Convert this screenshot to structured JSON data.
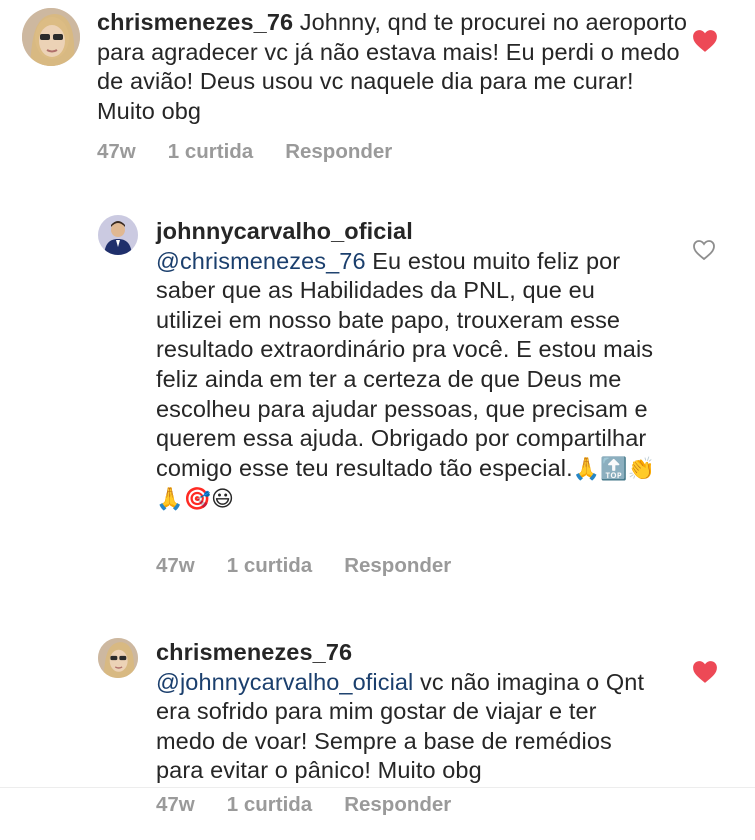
{
  "comments": [
    {
      "username": "chrismenezes_76",
      "mention": "",
      "body": " Johnny, qnd te procurei no aeroporto para agradecer vc já não estava mais! Eu perdi o medo de avião! Deus usou vc naquele dia para me curar! Muito obg",
      "age": "47w",
      "likes": "1 curtida",
      "reply_label": "Responder",
      "liked": true
    },
    {
      "username": "johnnycarvalho_oficial",
      "mention": "@chrismenezes_76",
      "body": " Eu estou muito feliz por saber que as Habilidades da PNL, que eu utilizei em nosso bate papo, trouxeram esse resultado extraordinário pra você. E estou mais feliz ainda em ter a certeza de que Deus me escolheu para ajudar pessoas, que precisam e querem essa ajuda. Obrigado por compartilhar comigo esse teu resultado tão especial.",
      "emojis": "🙏🔝👏🙏🎯😃",
      "age": "47w",
      "likes": "1 curtida",
      "reply_label": "Responder",
      "liked": false
    },
    {
      "username": "chrismenezes_76",
      "mention": "@johnnycarvalho_oficial",
      "body": " vc não imagina o Qnt era sofrido para mim gostar de viajar e ter medo de voar! Sempre a base de remédios para evitar o pânico! Muito obg",
      "age": "47w",
      "likes": "1 curtida",
      "reply_label": "Responder",
      "liked": true
    }
  ],
  "colors": {
    "liked_heart": "#ed4956",
    "mention": "#1b3f6d",
    "meta": "#9a9a9a"
  },
  "icons": {
    "liked": "filled-heart-icon",
    "unliked": "outline-heart-icon"
  }
}
